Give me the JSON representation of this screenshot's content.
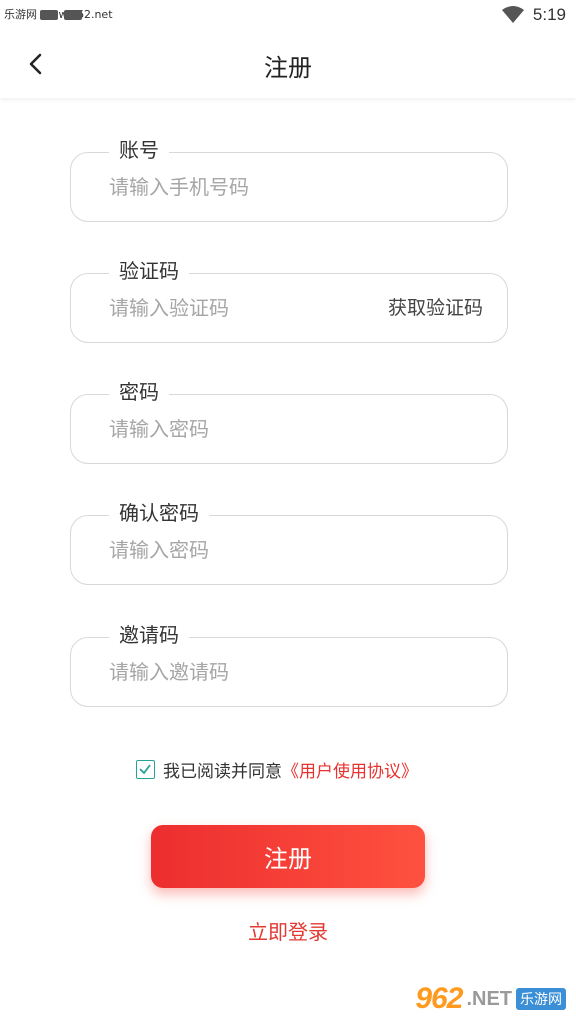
{
  "status_bar": {
    "watermark": "乐游网 www.962.net",
    "time": "5:19",
    "wifi_icon": "wifi-icon"
  },
  "nav": {
    "title": "注册",
    "back_icon": "chevron-left-icon"
  },
  "fields": {
    "account": {
      "label": "账号",
      "placeholder": "请输入手机号码"
    },
    "code": {
      "label": "验证码",
      "placeholder": "请输入验证码",
      "action": "获取验证码"
    },
    "password": {
      "label": "密码",
      "placeholder": "请输入密码"
    },
    "confirm": {
      "label": "确认密码",
      "placeholder": "请输入密码"
    },
    "invite": {
      "label": "邀请码",
      "placeholder": "请输入邀请码"
    }
  },
  "agreement": {
    "checked": true,
    "text": "我已阅读并同意",
    "link": "《用户使用协议》"
  },
  "register_button": "注册",
  "login_link": "立即登录",
  "watermark_bottom": {
    "logo": "962",
    "net": ".NET",
    "cn": "乐游网"
  },
  "colors": {
    "accent": "#e8322f",
    "checkbox": "#2aa198",
    "border": "#d8d8d8"
  }
}
